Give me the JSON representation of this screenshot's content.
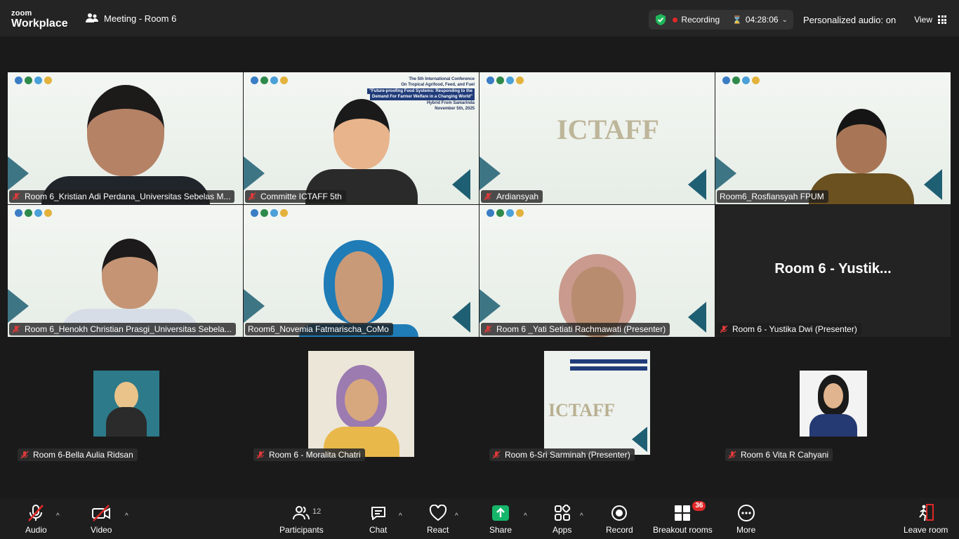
{
  "app": {
    "brand_line1": "zoom",
    "brand_line2": "Workplace"
  },
  "meeting": {
    "title": "Meeting - Room 6"
  },
  "status": {
    "recording_label": "Recording",
    "timer": "04:28:06",
    "audio": "Personalized audio: on",
    "view_label": "View"
  },
  "tiles": [
    {
      "name": "Room 6_Kristian Adi Perdana_Universitas Sebelas M..."
    },
    {
      "name": "Committe ICTAFF 5th"
    },
    {
      "name": "Ardiansyah"
    },
    {
      "name": "Room6_Rosfiansyah FPUM"
    },
    {
      "name": "Room 6_Henokh Christian Prasgi_Universitas Sebela..."
    },
    {
      "name": "Room6_Novemia Fatmarischa_CoMo"
    },
    {
      "name": "Room 6 _Yati Setiati Rachmawati (Presenter)"
    },
    {
      "name": "Room 6 - Yustika Dwi (Presenter)",
      "display": "Room 6 - Yustik..."
    }
  ],
  "thumbs": [
    {
      "name": "Room 6-Bella Aulia Ridsan"
    },
    {
      "name": "Room 6 - Moralita Chatri"
    },
    {
      "name": "Room 6-Sri Sarminah (Presenter)"
    },
    {
      "name": "Room 6 Vita R Cahyani"
    }
  ],
  "slide": {
    "title": "The 5th International Conference",
    "line2": "On Tropical Agrifood, Feed, and Fuel",
    "band1": "\"Future-proofing Food Systems: Responding to the",
    "band2": "Demand For Farmer Welfare in a Changing World\"",
    "line5": "Hybrid From Samarinda",
    "date": "November 5th, 2025",
    "logo_text": "ICTAFF"
  },
  "toolbar": {
    "audio": "Audio",
    "video": "Video",
    "participants": "Participants",
    "participants_count": "12",
    "chat": "Chat",
    "react": "React",
    "share": "Share",
    "apps": "Apps",
    "record": "Record",
    "breakout": "Breakout rooms",
    "breakout_count": "36",
    "more": "More",
    "leave": "Leave room"
  },
  "colors": {
    "accent_green": "#2fd37a",
    "record_red": "#e02828",
    "share_green": "#15b66a"
  }
}
